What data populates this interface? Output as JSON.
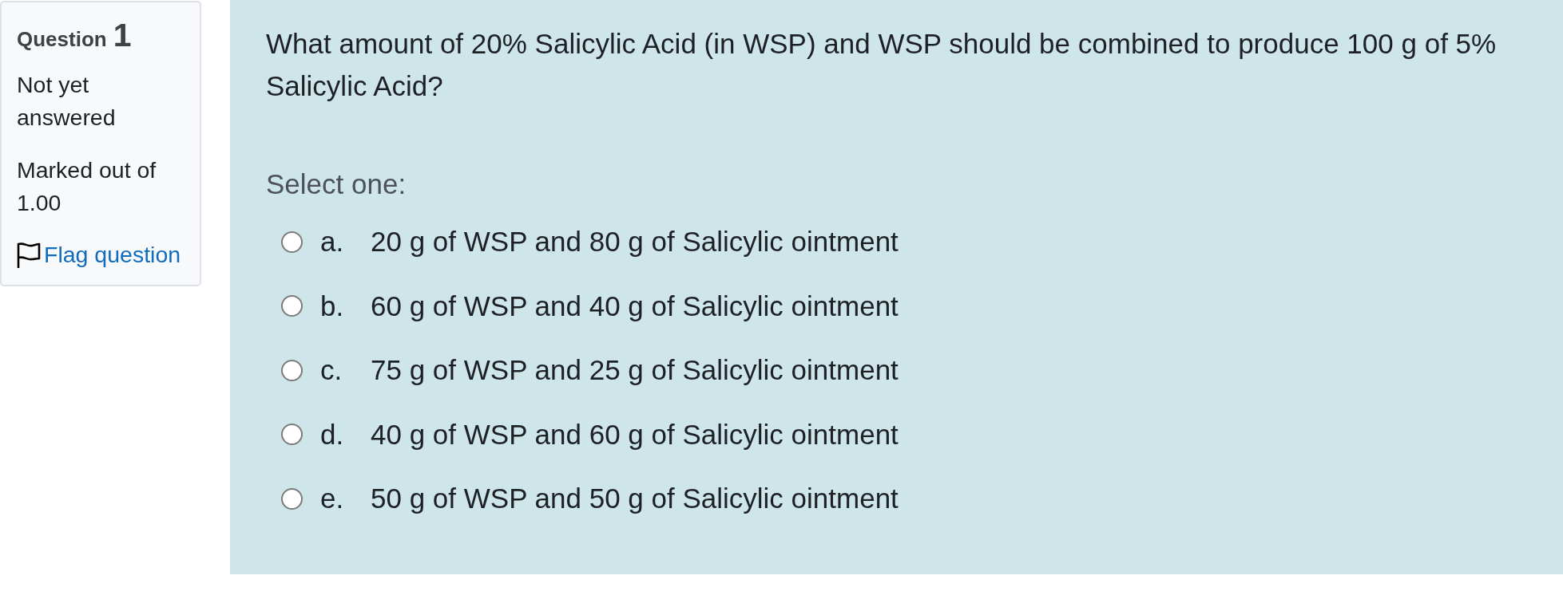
{
  "question_info": {
    "label": "Question",
    "number": "1",
    "state": "Not yet answered",
    "marks": "Marked out of 1.00",
    "flag": {
      "label": "Flag question",
      "flagged": false
    }
  },
  "question": {
    "text": "What amount of 20% Salicylic Acid (in WSP) and WSP should be combined to produce 100 g of 5% Salicylic Acid?",
    "prompt": "Select one:",
    "options": [
      {
        "letter": "a.",
        "text": "20 g of WSP and 80 g of Salicylic ointment",
        "selected": false
      },
      {
        "letter": "b.",
        "text": "60 g of WSP and 40 g of Salicylic ointment",
        "selected": false
      },
      {
        "letter": "c.",
        "text": "75 g of WSP and 25 g of Salicylic ointment",
        "selected": false
      },
      {
        "letter": "d.",
        "text": "40 g of WSP and 60 g of Salicylic ointment",
        "selected": false
      },
      {
        "letter": "e.",
        "text": "50 g of WSP and 50 g of Salicylic ointment",
        "selected": false
      }
    ]
  }
}
